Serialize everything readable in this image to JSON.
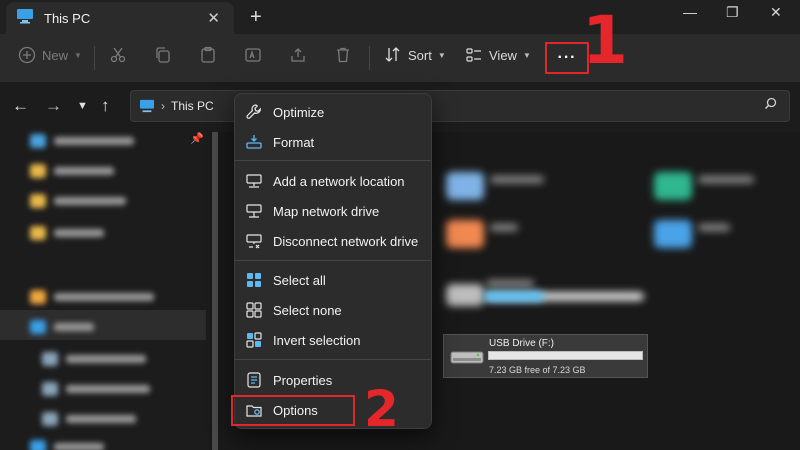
{
  "window": {
    "tab_title": "This PC",
    "tab_close": "✕",
    "new_tab": "+",
    "minimize": "—",
    "restore": "❐",
    "close": "✕"
  },
  "toolbar": {
    "new_label": "New",
    "sort_label": "Sort",
    "view_label": "View",
    "more_label": "···"
  },
  "address": {
    "location": "This PC",
    "separator": "›"
  },
  "menu": {
    "items": [
      {
        "label": "Optimize",
        "icon": "wrench-icon"
      },
      {
        "label": "Format",
        "icon": "format-drive-icon"
      },
      {
        "label": "Add a network location",
        "icon": "add-network-location-icon"
      },
      {
        "label": "Map network drive",
        "icon": "map-network-drive-icon"
      },
      {
        "label": "Disconnect network drive",
        "icon": "disconnect-network-drive-icon"
      },
      {
        "label": "Select all",
        "icon": "select-all-icon"
      },
      {
        "label": "Select none",
        "icon": "select-none-icon"
      },
      {
        "label": "Invert selection",
        "icon": "invert-selection-icon"
      },
      {
        "label": "Properties",
        "icon": "properties-icon"
      },
      {
        "label": "Options",
        "icon": "options-icon"
      }
    ]
  },
  "drive": {
    "name": "USB Drive (F:)",
    "free_text": "7.23 GB free of 7.23 GB",
    "used_fraction": 0
  },
  "annotations": {
    "marker_1": "1",
    "marker_2": "2",
    "color": "#e0282c"
  },
  "colors": {
    "accent": "#4cc2ff",
    "menu_bg": "#2c2c2c",
    "toolbar_bg": "#2b2b2b"
  }
}
